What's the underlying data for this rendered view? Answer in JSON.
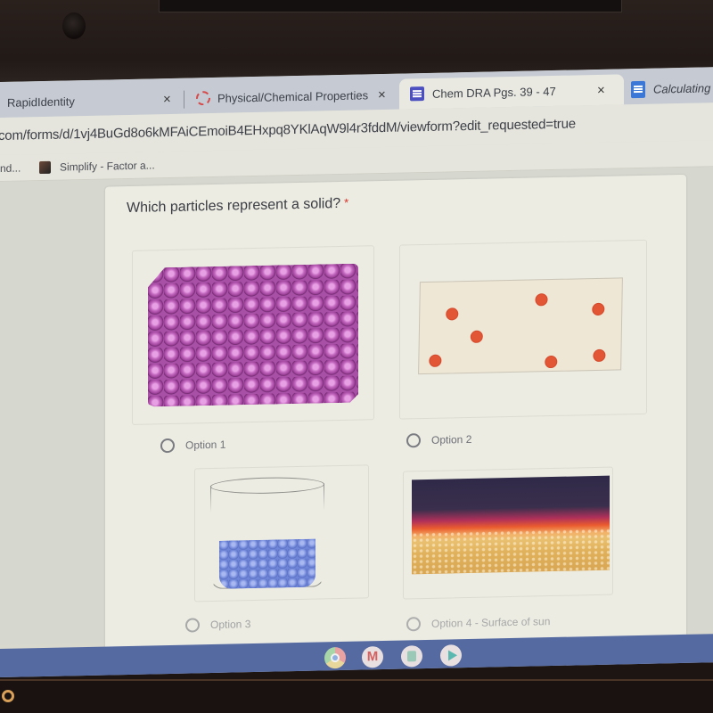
{
  "browser": {
    "tabs": [
      {
        "title": "RapidIdentity",
        "icon": "none",
        "active": false,
        "close": "×"
      },
      {
        "title": "Physical/Chemical Properties",
        "icon": "loading-ring-icon",
        "active": false,
        "close": "×"
      },
      {
        "title": "Chem DRA Pgs. 39 - 47",
        "icon": "google-forms-icon",
        "active": true,
        "close": "×"
      },
      {
        "title": "Calculating",
        "icon": "google-docs-icon",
        "active": false
      }
    ],
    "url": "com/forms/d/1vj4BuGd8o6kMFAiCEmoiB4EHxpq8YKlAqW9l4r3fddM/viewform?edit_requested=true",
    "bookmarks": [
      {
        "label": "nd..."
      },
      {
        "label": "Simplify - Factor a...",
        "icon": "cube-icon"
      }
    ]
  },
  "form": {
    "question": "Which particles represent a solid?",
    "required_marker": "*",
    "options": [
      {
        "label": "Option 1",
        "image": "tightly packed purple spheres (solid lattice)",
        "selected": false
      },
      {
        "label": "Option 2",
        "image": "sparse red dots in a box (gas)",
        "selected": false
      },
      {
        "label": "Option 3",
        "image": "blue spheres in a beaker (liquid)",
        "selected": false
      },
      {
        "label": "Option 4 - Surface of sun",
        "image": "surface of the sun (plasma)",
        "selected": false
      }
    ],
    "colors": {
      "solid_particles": "#a84fa6",
      "gas_particles": "#e25535",
      "liquid_particles": "#6f86d8",
      "required": "#d93025"
    }
  },
  "shelf": {
    "apps": [
      "chrome-icon",
      "gmail-icon",
      "files-icon",
      "play-store-icon"
    ]
  }
}
